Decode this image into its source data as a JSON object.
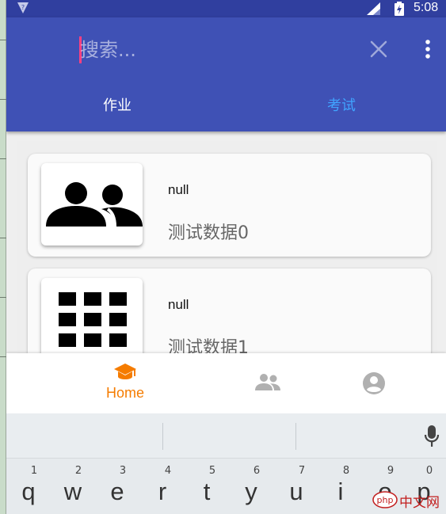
{
  "status_bar": {
    "time": "5:08",
    "notification_badge": "?"
  },
  "search": {
    "placeholder": "搜索..."
  },
  "tabs": [
    {
      "label": "作业",
      "selected": true
    },
    {
      "label": "考试",
      "selected": false
    }
  ],
  "cards": [
    {
      "title": "null",
      "description": "测试数据0",
      "icon": "group-icon"
    },
    {
      "title": "null",
      "description": "测试数据1",
      "icon": "grid-icon"
    }
  ],
  "bottom_nav": {
    "home_label": "Home",
    "items": [
      "school-icon",
      "group-icon",
      "account-circle-icon"
    ]
  },
  "keyboard": {
    "number_row": [
      "1",
      "2",
      "3",
      "4",
      "5",
      "6",
      "7",
      "8",
      "9",
      "0"
    ],
    "letter_row": [
      "q",
      "w",
      "e",
      "r",
      "t",
      "y",
      "u",
      "i",
      "o",
      "p"
    ]
  },
  "watermark": {
    "text": "中文网"
  },
  "colors": {
    "status_bar": "#303f9f",
    "app_bar": "#3f51b5",
    "accent_cursor": "#ff4081",
    "tab_inactive": "#40a4ff",
    "nav_active": "#f57c00",
    "nav_inactive": "#b0b0b0"
  }
}
